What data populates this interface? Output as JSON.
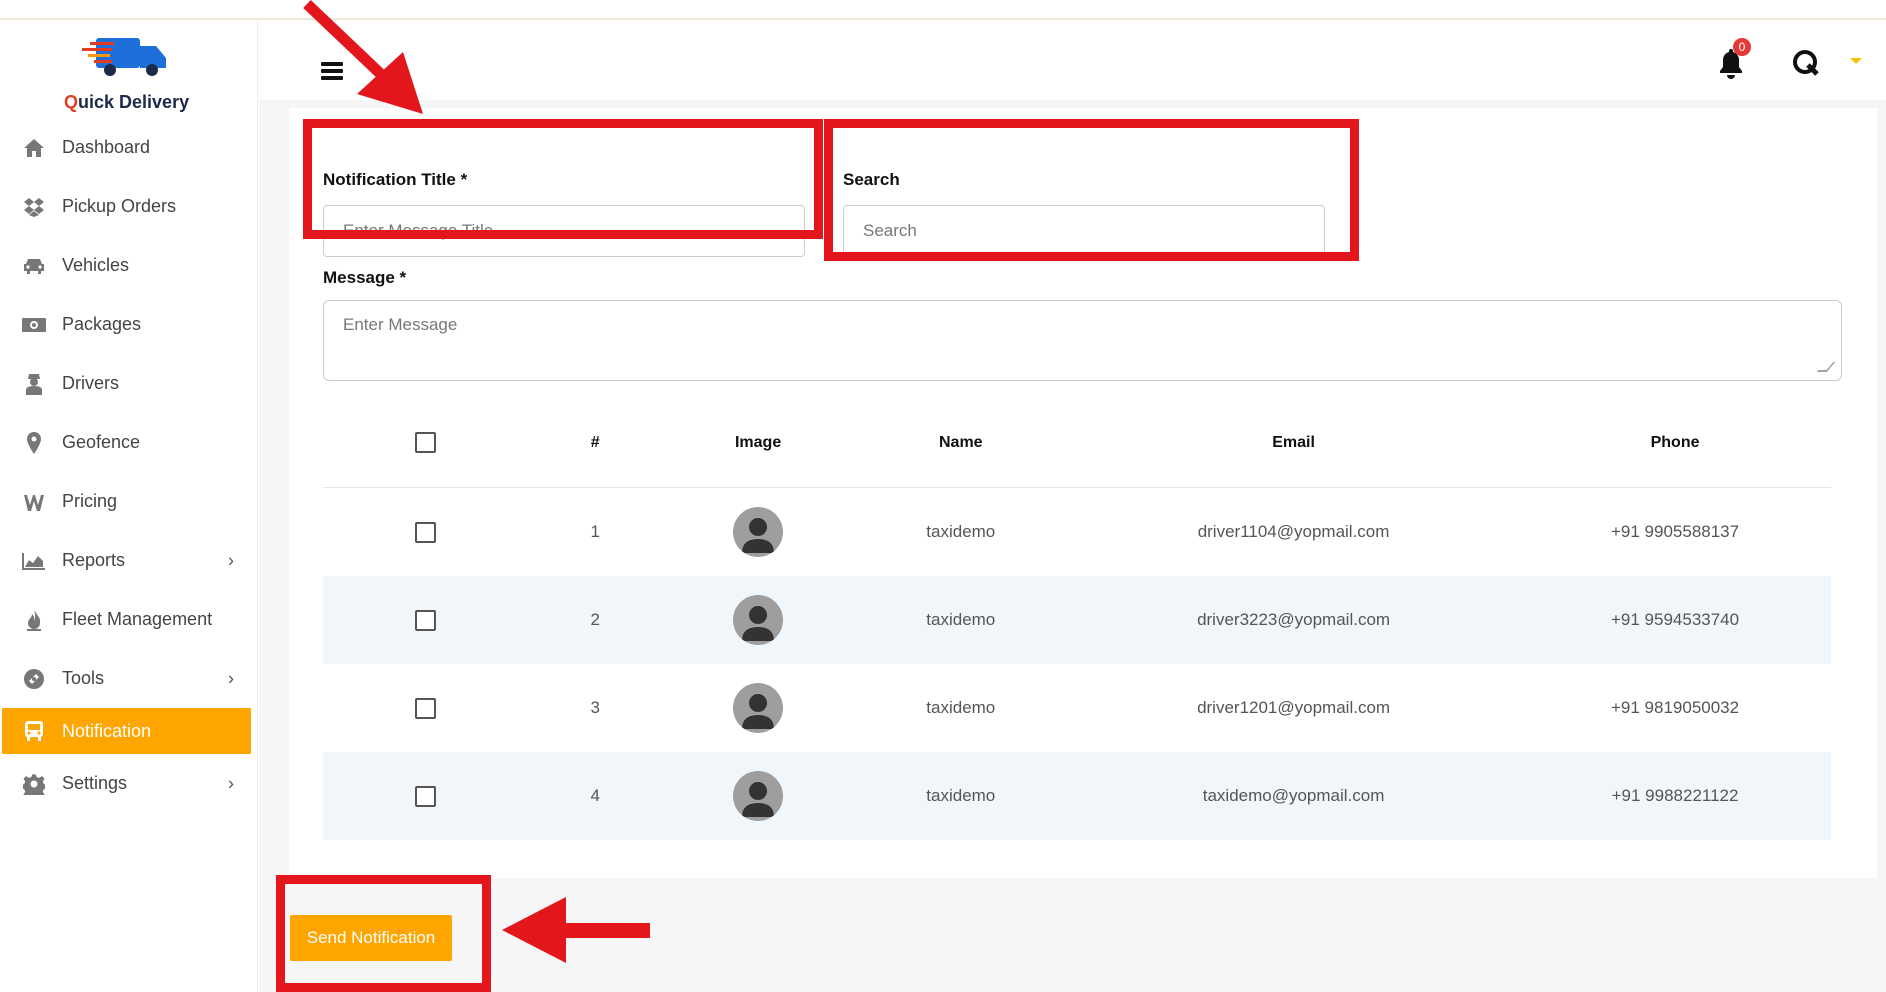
{
  "app": {
    "logo_text_q": "Q",
    "logo_text_rest": "uick Delivery"
  },
  "sidebar": {
    "items": [
      {
        "label": "Dashboard",
        "icon": "home-icon",
        "chevron": false,
        "active": false
      },
      {
        "label": "Pickup Orders",
        "icon": "dropbox-icon",
        "chevron": false,
        "active": false
      },
      {
        "label": "Vehicles",
        "icon": "car-icon",
        "chevron": false,
        "active": false
      },
      {
        "label": "Packages",
        "icon": "money-icon",
        "chevron": false,
        "active": false
      },
      {
        "label": "Drivers",
        "icon": "user-secret-icon",
        "chevron": false,
        "active": false
      },
      {
        "label": "Geofence",
        "icon": "map-marker-icon",
        "chevron": false,
        "active": false
      },
      {
        "label": "Pricing",
        "icon": "pricing-icon",
        "chevron": false,
        "active": false
      },
      {
        "label": "Reports",
        "icon": "area-chart-icon",
        "chevron": true,
        "active": false
      },
      {
        "label": "Fleet Management",
        "icon": "fire-icon",
        "chevron": false,
        "active": false
      },
      {
        "label": "Tools",
        "icon": "tools-icon",
        "chevron": true,
        "active": false
      },
      {
        "label": "Notification",
        "icon": "bus-icon",
        "chevron": false,
        "active": true
      },
      {
        "label": "Settings",
        "icon": "gear-icon",
        "chevron": true,
        "active": false
      }
    ]
  },
  "header": {
    "notification_count": "0"
  },
  "form": {
    "title_label": "Notification Title *",
    "title_placeholder": "Enter Message Title",
    "search_label": "Search",
    "search_placeholder": "Search",
    "message_label": "Message *",
    "message_placeholder": "Enter Message"
  },
  "table": {
    "headers": {
      "num": "#",
      "image": "Image",
      "name": "Name",
      "email": "Email",
      "phone": "Phone"
    },
    "rows": [
      {
        "num": "1",
        "name": "taxidemo",
        "email": "driver1104@yopmail.com",
        "phone": "+91 9905588137"
      },
      {
        "num": "2",
        "name": "taxidemo",
        "email": "driver3223@yopmail.com",
        "phone": "+91 9594533740"
      },
      {
        "num": "3",
        "name": "taxidemo",
        "email": "driver1201@yopmail.com",
        "phone": "+91 9819050032"
      },
      {
        "num": "4",
        "name": "taxidemo",
        "email": "taxidemo@yopmail.com",
        "phone": "+91 9988221122"
      }
    ]
  },
  "actions": {
    "send_label": "Send Notification"
  },
  "colors": {
    "accent": "#ffa500",
    "annotation_red": "#e3161c",
    "badge": "#e53935"
  }
}
